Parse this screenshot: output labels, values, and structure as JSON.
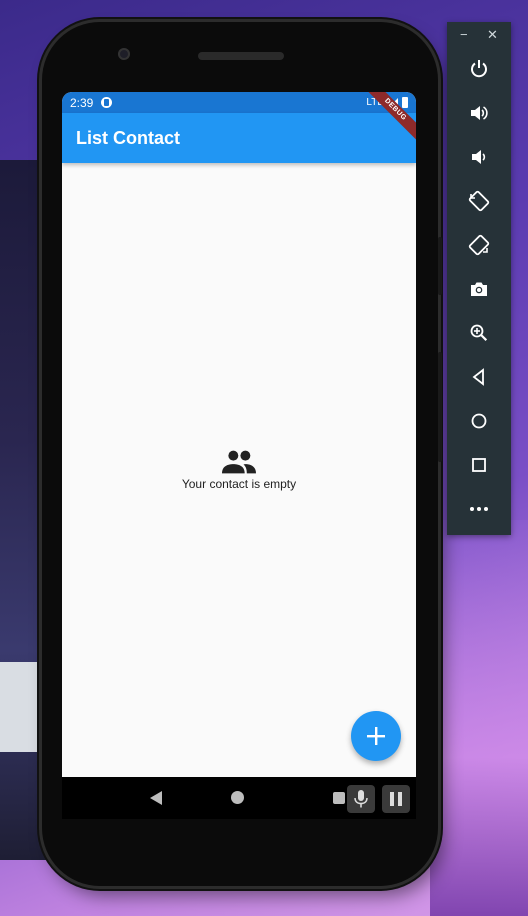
{
  "status_bar": {
    "time": "2:39",
    "network": "LTE"
  },
  "app": {
    "title": "List Contact",
    "debug_banner": "DEBUG",
    "empty_message": "Your contact is empty",
    "fab_icon": "plus-icon",
    "empty_icon": "people-icon"
  },
  "emulator_toolbar": {
    "window_controls": {
      "minimize": "−",
      "close": "✕"
    },
    "buttons": [
      "power-icon",
      "volume-up-icon",
      "volume-down-icon",
      "rotate-left-icon",
      "rotate-right-icon",
      "camera-icon",
      "zoom-icon",
      "back-icon",
      "home-icon",
      "overview-icon",
      "more-icon"
    ]
  },
  "colors": {
    "appbar": "#2196f3",
    "statusbar": "#1976d2",
    "fab": "#2196f3",
    "toolbar": "#263238",
    "screen_bg": "#fafafa"
  }
}
